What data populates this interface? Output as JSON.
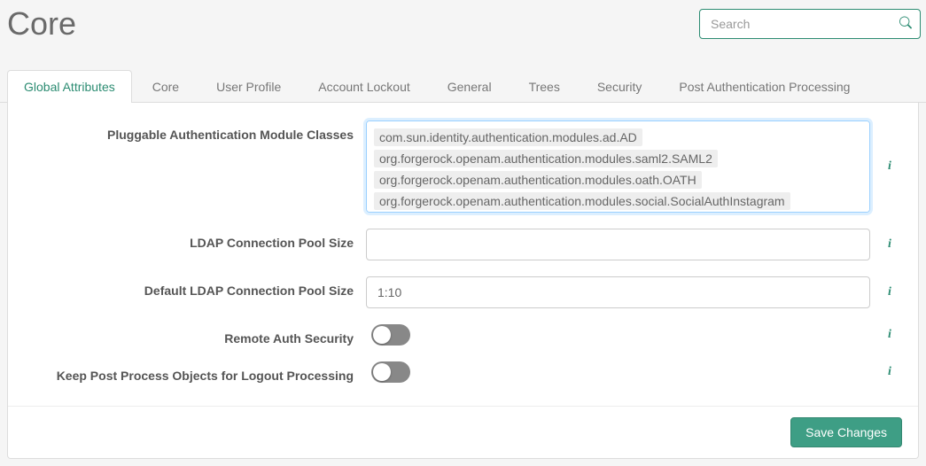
{
  "header": {
    "title": "Core",
    "search_placeholder": "Search"
  },
  "tabs": [
    {
      "label": "Global Attributes",
      "active": true
    },
    {
      "label": "Core",
      "active": false
    },
    {
      "label": "User Profile",
      "active": false
    },
    {
      "label": "Account Lockout",
      "active": false
    },
    {
      "label": "General",
      "active": false
    },
    {
      "label": "Trees",
      "active": false
    },
    {
      "label": "Security",
      "active": false
    },
    {
      "label": "Post Authentication Processing",
      "active": false
    }
  ],
  "form": {
    "pluggable": {
      "label": "Pluggable Authentication Module Classes",
      "items": [
        "com.sun.identity.authentication.modules.ad.AD",
        "org.forgerock.openam.authentication.modules.saml2.SAML2",
        "org.forgerock.openam.authentication.modules.oath.OATH",
        "org.forgerock.openam.authentication.modules.social.SocialAuthInstagram"
      ]
    },
    "ldap_pool": {
      "label": "LDAP Connection Pool Size",
      "value": ""
    },
    "default_ldap_pool": {
      "label": "Default LDAP Connection Pool Size",
      "value": "1:10"
    },
    "remote_auth_security": {
      "label": "Remote Auth Security",
      "value": false
    },
    "keep_post_process": {
      "label": "Keep Post Process Objects for Logout Processing",
      "value": false
    }
  },
  "footer": {
    "save_label": "Save Changes"
  }
}
